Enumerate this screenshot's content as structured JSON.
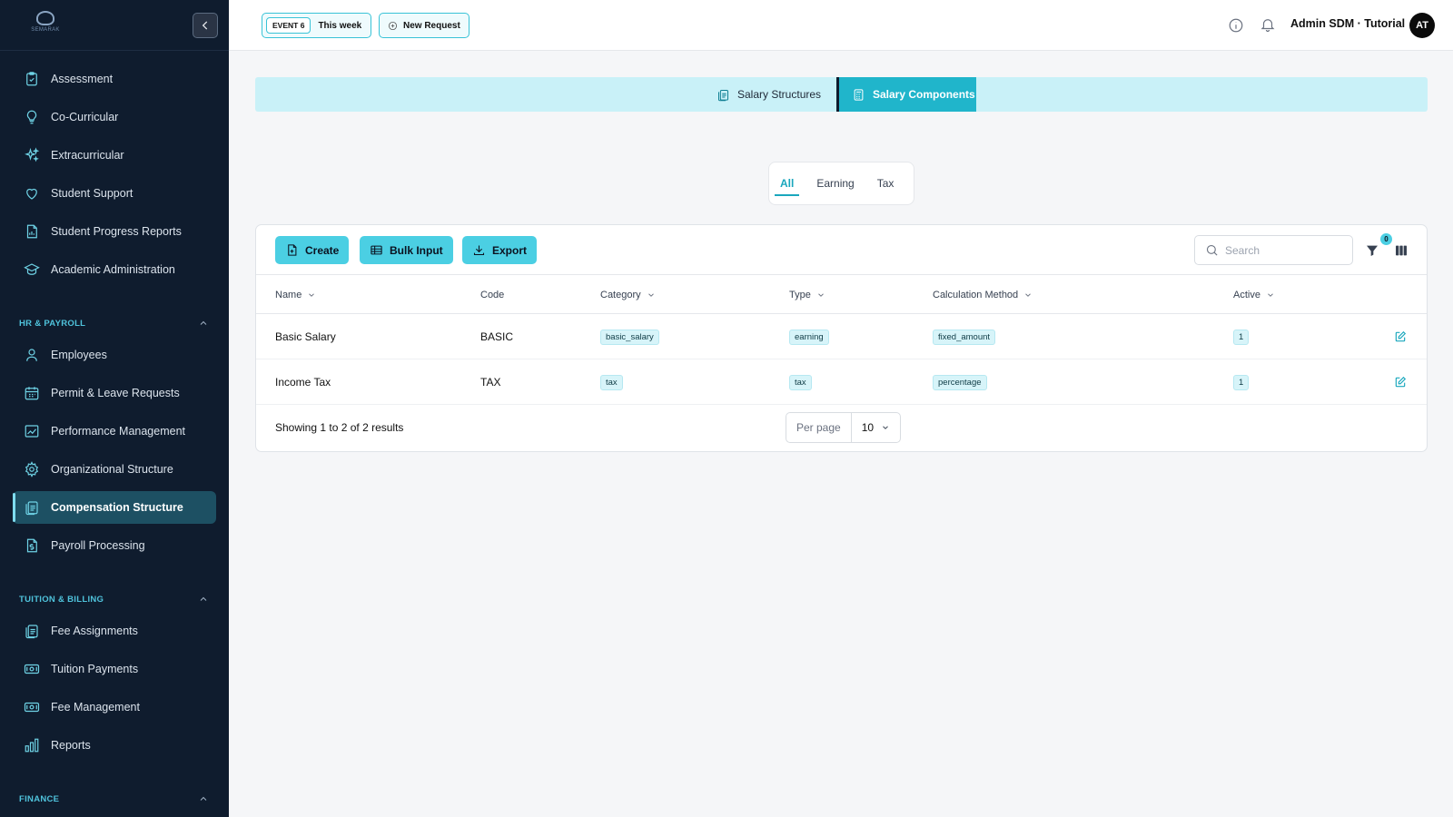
{
  "sidebar": {
    "logo_text": "SEMARAK",
    "items_top": [
      {
        "label": "Assessment",
        "icon": "clipboard-check-icon"
      },
      {
        "label": "Co-Curricular",
        "icon": "lightbulb-icon"
      },
      {
        "label": "Extracurricular",
        "icon": "sparkles-icon"
      },
      {
        "label": "Student Support",
        "icon": "heart-icon"
      },
      {
        "label": "Student Progress Reports",
        "icon": "report-icon"
      },
      {
        "label": "Academic Administration",
        "icon": "graduation-cap-icon"
      }
    ],
    "section_hr": "HR & PAYROLL",
    "items_hr": [
      {
        "label": "Employees",
        "icon": "user-icon"
      },
      {
        "label": "Permit & Leave Requests",
        "icon": "calendar-icon"
      },
      {
        "label": "Performance Management",
        "icon": "chart-icon"
      },
      {
        "label": "Organizational Structure",
        "icon": "gear-icon"
      },
      {
        "label": "Compensation Structure",
        "icon": "clipboard-icon"
      },
      {
        "label": "Payroll Processing",
        "icon": "dollar-file-icon"
      }
    ],
    "section_tuition": "TUITION & BILLING",
    "items_tuition": [
      {
        "label": "Fee Assignments",
        "icon": "clipboard-icon"
      },
      {
        "label": "Tuition Payments",
        "icon": "money-icon"
      },
      {
        "label": "Fee Management",
        "icon": "money-icon"
      },
      {
        "label": "Reports",
        "icon": "bar-chart-icon"
      }
    ],
    "section_finance": "FINANCE"
  },
  "topbar": {
    "event_badge": "EVENT 6",
    "event_week": "This week",
    "new_request": "New Request",
    "user_name": "Admin SDM · Tutorial",
    "avatar_initials": "AT"
  },
  "tabs": {
    "structures": "Salary Structures",
    "components": "Salary Components"
  },
  "filters": [
    "All",
    "Earning",
    "Tax"
  ],
  "toolbar": {
    "create": "Create",
    "bulk_input": "Bulk Input",
    "export": "Export",
    "search_placeholder": "Search",
    "filter_count": "0"
  },
  "table": {
    "headers": {
      "name": "Name",
      "code": "Code",
      "category": "Category",
      "type": "Type",
      "calc": "Calculation Method",
      "active": "Active"
    },
    "rows": [
      {
        "name": "Basic Salary",
        "code": "BASIC",
        "category": "basic_salary",
        "type": "earning",
        "calc": "fixed_amount",
        "active": "1"
      },
      {
        "name": "Income Tax",
        "code": "TAX",
        "category": "tax",
        "type": "tax",
        "calc": "percentage",
        "active": "1"
      }
    ]
  },
  "footer": {
    "showing": "Showing 1 to 2 of 2 results",
    "per_page_label": "Per page",
    "per_page_value": "10"
  },
  "colors": {
    "sidebar_bg": "#0f1c2e",
    "accent": "#4bcfe3",
    "active_tab": "#20b5cb",
    "section_title": "#4fc3dc"
  }
}
